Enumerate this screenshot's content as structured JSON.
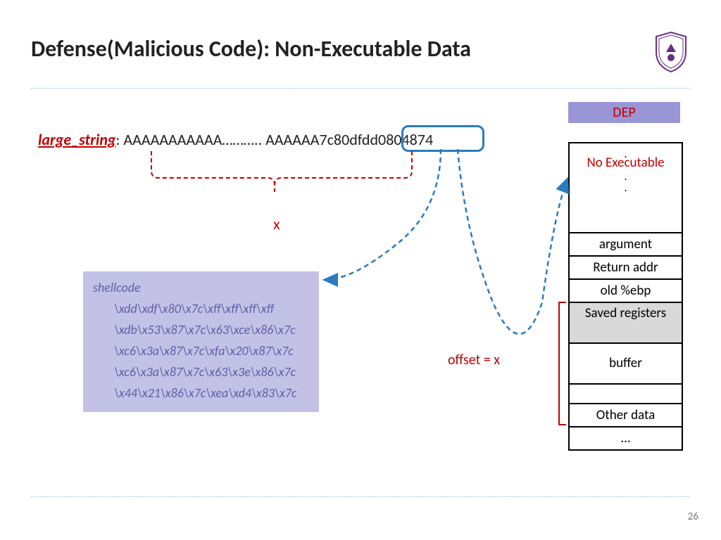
{
  "title": "Defense(Malicious Code): Non-Executable Data",
  "large_string": {
    "label": "large_string",
    "sep": ": ",
    "content_a": "AAAAAAAAAAA……….. AAAAAA",
    "content_hilite": "7c80dfdd",
    "content_b": "0804874"
  },
  "dep_label": "DEP",
  "stack": {
    "noexec": "No Executable",
    "dots_top": ".",
    "argument": "argument",
    "return_addr": "Return addr",
    "old_ebp": "old %ebp",
    "saved_registers": "Saved registers",
    "buffer": "buffer",
    "other_data": "Other data",
    "ellipsis": "…"
  },
  "offset_label": "offset = x",
  "x_label": "x",
  "shellcode": {
    "header": "shellcode",
    "lines": [
      "\\xdd\\xdf\\x80\\x7c\\xff\\xff\\xff\\xff",
      "\\xdb\\x53\\x87\\x7c\\x63\\xce\\x86\\x7c",
      "\\xc6\\x3a\\x87\\x7c\\xfa\\x20\\x87\\x7c",
      "\\xc6\\x3a\\x87\\x7c\\x63\\x3e\\x86\\x7c",
      "\\x44\\x21\\x86\\x7c\\xea\\xd4\\x83\\x7c"
    ]
  },
  "page_number": "26"
}
